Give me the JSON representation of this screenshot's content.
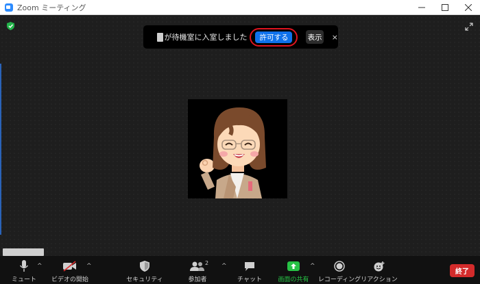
{
  "window": {
    "title": "Zoom ミーティング"
  },
  "notification": {
    "message": "が待機室に入室しました",
    "allow_label": "許可する",
    "show_label": "表示",
    "close_label": "×"
  },
  "toolbar": {
    "mute_label": "ミュート",
    "video_label": "ビデオの開始",
    "security_label": "セキュリティ",
    "participants_label": "参加者",
    "participants_count": "2",
    "chat_label": "チャット",
    "share_label": "画面の共有",
    "record_label": "レコーディング",
    "reactions_label": "リアクション",
    "end_label": "終了",
    "caret": "^"
  },
  "colors": {
    "accent_blue": "#0e71eb",
    "highlight_red": "#e0141f",
    "share_green": "#27c245",
    "end_red": "#d32b2b"
  },
  "icons": {
    "shield": "shield-check-icon",
    "fullscreen": "expand-icon",
    "mute": "microphone-icon",
    "video": "video-off-icon",
    "security": "shield-icon",
    "participants": "people-icon",
    "chat": "chat-bubble-icon",
    "share": "share-screen-icon",
    "record": "record-icon",
    "reactions": "emoji-plus-icon"
  }
}
